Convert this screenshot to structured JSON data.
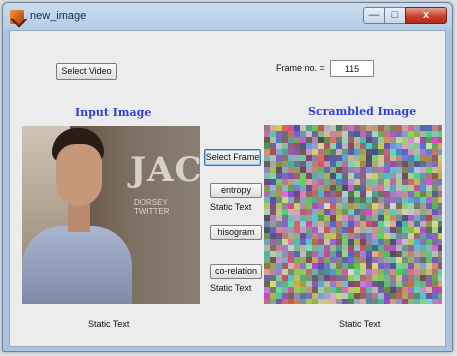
{
  "window": {
    "title": "new_image"
  },
  "controls": {
    "minimize": "—",
    "maximize": "□",
    "close": "x"
  },
  "buttons": {
    "select_video": "Select Video",
    "select_frame": "Select Frame",
    "entropy": "entropy",
    "histogram": "hisogram",
    "correlation": "co-relation"
  },
  "frame": {
    "label": "Frame no. =",
    "value": "115"
  },
  "headings": {
    "input": "Input Image",
    "scrambled": "Scrambled Image"
  },
  "static_texts": {
    "entropy": "Static Text",
    "correlation": "Static Text",
    "input_bottom": "Static Text",
    "scrambled_bottom": "Static Text"
  },
  "input_image": {
    "logo": "JACK",
    "subtitle": "DORSEY TWITTER"
  },
  "icons": {
    "app": "matlab-figure-icon",
    "minimize": "minimize-icon",
    "maximize": "maximize-icon",
    "close": "close-icon"
  }
}
